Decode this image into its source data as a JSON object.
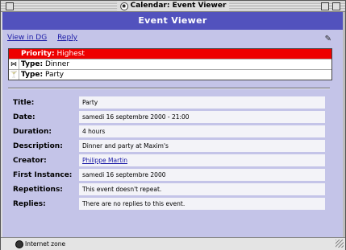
{
  "window": {
    "title": "Calendar: Event Viewer"
  },
  "header": {
    "title": "Event Viewer"
  },
  "toolbar": {
    "view_in_dg": "View in DG",
    "reply": "Reply",
    "edit_icon": "pencil-icon"
  },
  "summary": {
    "priority": {
      "label": "Priority:",
      "value": "Highest",
      "color": "#ee0000"
    },
    "types": [
      {
        "icon": "bowtie-icon",
        "label": "Type:",
        "value": "Dinner"
      },
      {
        "icon": "cocktail-icon",
        "label": "Type:",
        "value": "Party"
      }
    ]
  },
  "details": [
    {
      "label": "Title:",
      "value": "Party"
    },
    {
      "label": "Date:",
      "value": "samedi 16 septembre 2000 - 21:00"
    },
    {
      "label": "Duration:",
      "value": "4 hours"
    },
    {
      "label": "Description:",
      "value": "Dinner and party at Maxim's"
    },
    {
      "label": "Creator:",
      "value": "Philippe Martin",
      "link": true
    },
    {
      "label": "First Instance:",
      "value": "samedi 16 septembre 2000"
    },
    {
      "label": "Repetitions:",
      "value": "This event doesn't repeat."
    },
    {
      "label": "Replies:",
      "value": "There are no replies to this event."
    }
  ],
  "status": {
    "text": "Internet zone",
    "icon": "globe-icon"
  },
  "colors": {
    "header_bg": "#5252bd",
    "content_bg": "#c4c4e8",
    "link": "#1a1aa6"
  }
}
